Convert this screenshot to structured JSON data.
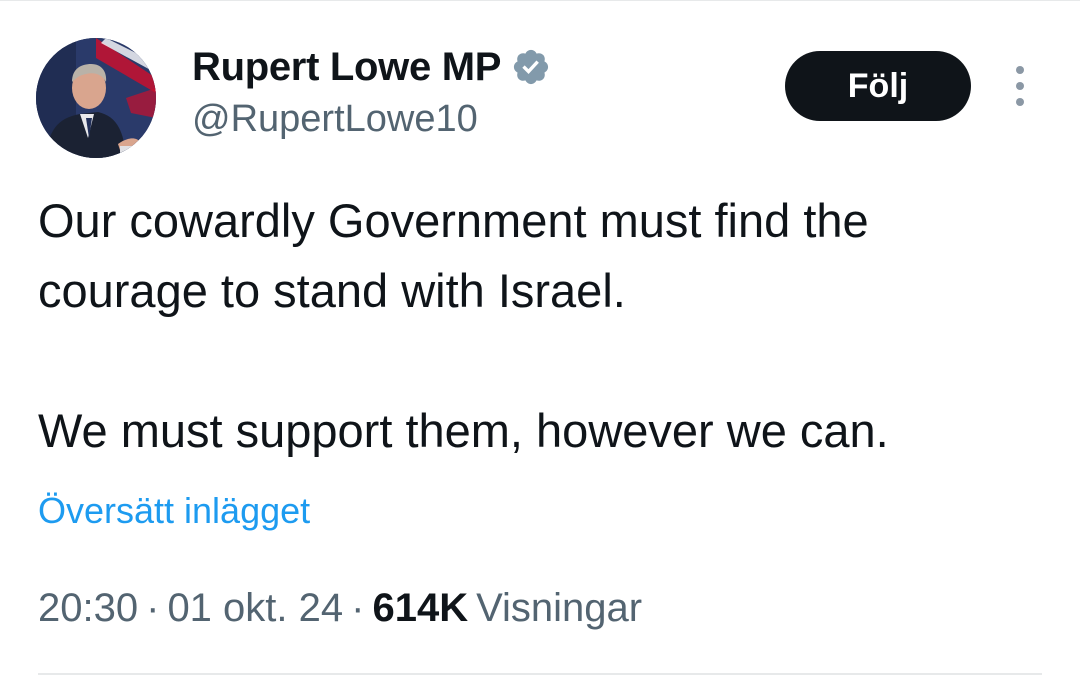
{
  "user": {
    "display_name": "Rupert Lowe MP",
    "handle": "@RupertLowe10",
    "verified_icon": "verified-badge-icon",
    "avatar": "profile-photo"
  },
  "actions": {
    "follow_label": "Följ",
    "more_icon": "more-vertical-icon"
  },
  "tweet": {
    "paragraphs": [
      "Our cowardly Government must find the courage to stand with Israel.",
      "We must support them, however we can."
    ],
    "translate_label": "Översätt inlägget",
    "time": "20:30",
    "date": "01 okt. 24",
    "separator": "·",
    "views_count": "614K",
    "views_label": "Visningar"
  },
  "colors": {
    "text": "#0f1419",
    "secondary": "#536471",
    "link": "#1d9bf0",
    "verified": "#829aab",
    "button_bg": "#0f1419"
  }
}
